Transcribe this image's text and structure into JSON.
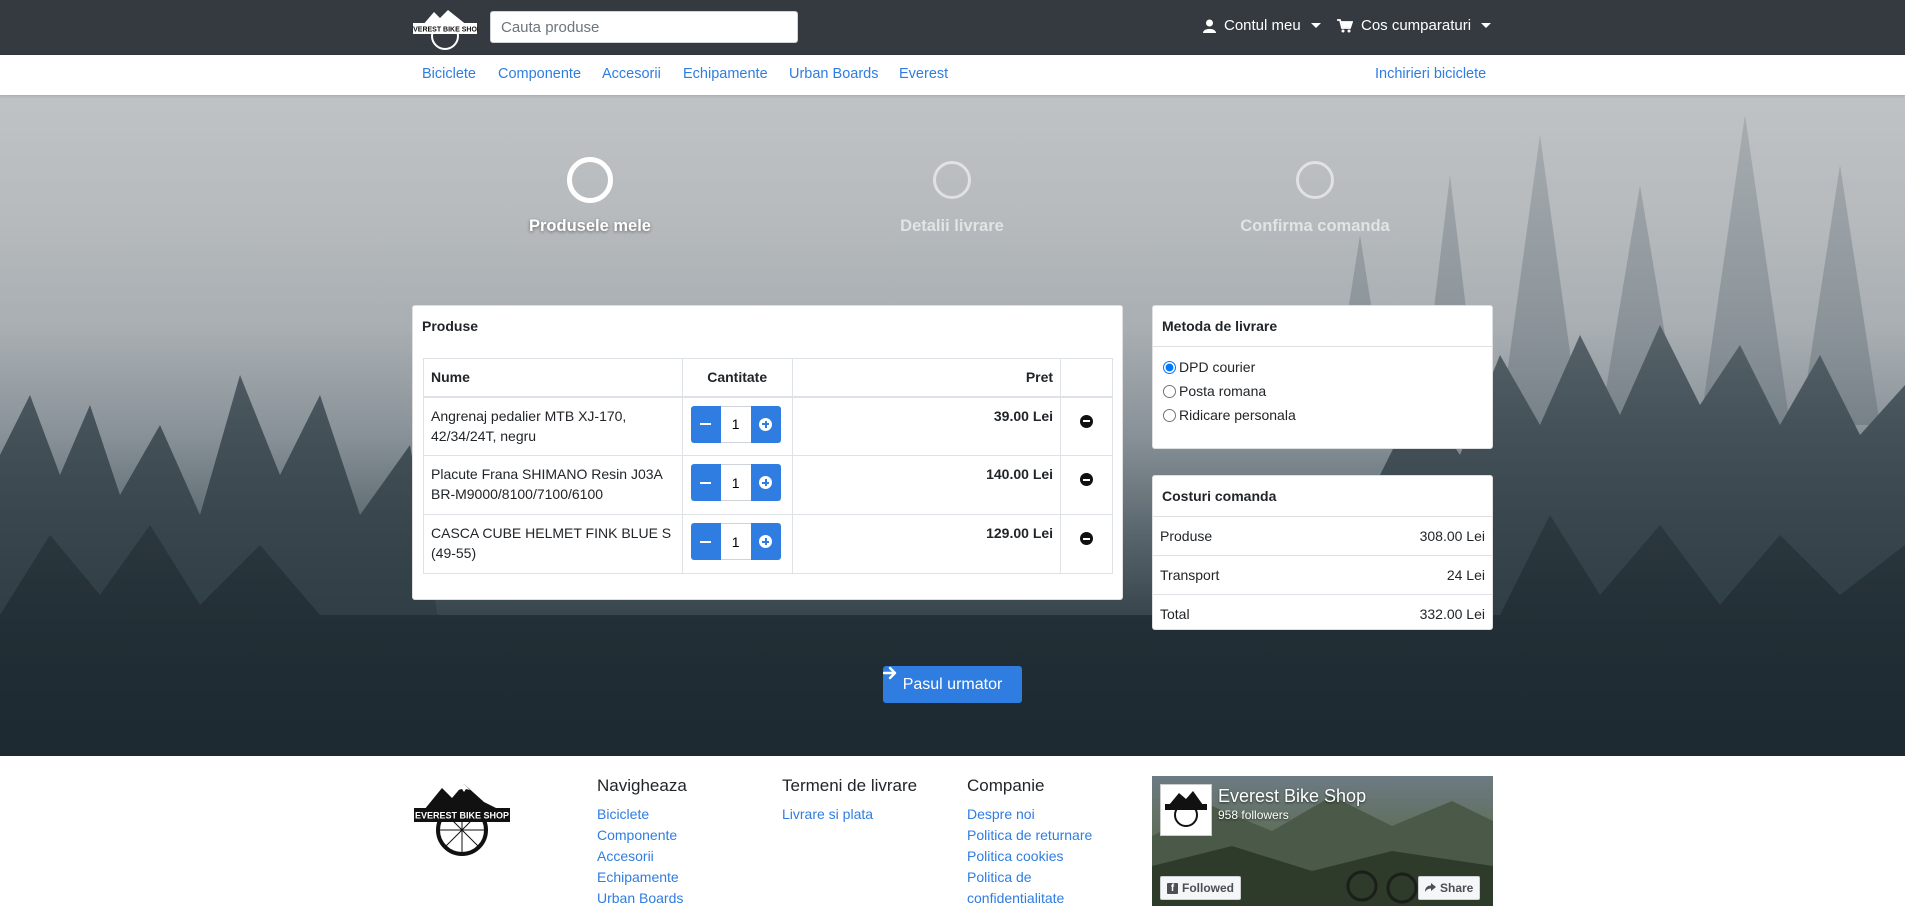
{
  "header": {
    "logo_text": "EVEREST BIKE SHOP",
    "search_placeholder": "Cauta produse",
    "account_label": "Contul meu",
    "cart_label": "Cos cumparaturi"
  },
  "nav": {
    "items": [
      "Biciclete",
      "Componente",
      "Accesorii",
      "Echipamente",
      "Urban Boards",
      "Everest"
    ],
    "right_link": "Inchirieri biciclete"
  },
  "steps": [
    {
      "label": "Produsele mele",
      "state": "active"
    },
    {
      "label": "Detalii livrare",
      "state": "inactive"
    },
    {
      "label": "Confirma comanda",
      "state": "inactive"
    }
  ],
  "products_card": {
    "title": "Produse",
    "columns": [
      "Nume",
      "Cantitate",
      "Pret"
    ],
    "rows": [
      {
        "name": "Angrenaj pedalier MTB XJ-170, 42/34/24T, negru",
        "qty": "1",
        "price": "39.00 Lei"
      },
      {
        "name": "Placute Frana SHIMANO Resin J03A BR-M9000/8100/7100/6100",
        "qty": "1",
        "price": "140.00 Lei"
      },
      {
        "name": "CASCA CUBE HELMET FINK BLUE S (49-55)",
        "qty": "1",
        "price": "129.00 Lei"
      }
    ]
  },
  "delivery": {
    "title": "Metoda de livrare",
    "options": [
      {
        "label": "DPD courier",
        "checked": true
      },
      {
        "label": "Posta romana",
        "checked": false
      },
      {
        "label": "Ridicare personala",
        "checked": false
      }
    ]
  },
  "costs": {
    "title": "Costuri comanda",
    "rows": [
      {
        "label": "Produse",
        "value": "308.00 Lei"
      },
      {
        "label": "Transport",
        "value": "24 Lei"
      },
      {
        "label": "Total",
        "value": "332.00 Lei"
      }
    ]
  },
  "next_button": "Pasul urmator",
  "footer": {
    "nav_title": "Navigheaza",
    "nav_links": [
      "Biciclete",
      "Componente",
      "Accesorii",
      "Echipamente",
      "Urban Boards"
    ],
    "terms_title": "Termeni de livrare",
    "terms_links": [
      "Livrare si plata"
    ],
    "company_title": "Companie",
    "company_links": [
      "Despre noi",
      "Politica de returnare",
      "Politica cookies",
      "Politica de confidentialitate"
    ],
    "facebook": {
      "page_name": "Everest Bike Shop",
      "followers": "958 followers",
      "followed_label": "Followed",
      "share_label": "Share"
    }
  },
  "colors": {
    "topbar": "#343a40",
    "accent": "#2f7de1"
  }
}
